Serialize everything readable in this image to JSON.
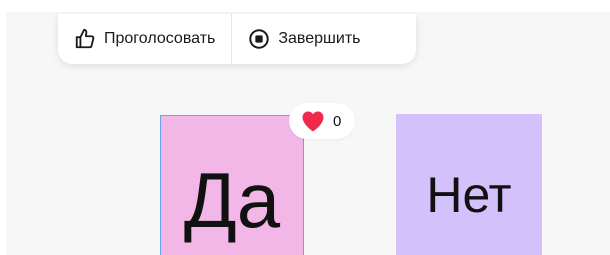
{
  "toolbar": {
    "vote_label": "Проголосовать",
    "finish_label": "Завершить"
  },
  "stickies": {
    "yes_text": "Да",
    "no_text": "Нет"
  },
  "reactions": {
    "like_count": "0"
  },
  "colors": {
    "sticky_yes_bg": "#f2b7e6",
    "sticky_no_bg": "#d2c1fb",
    "heart": "#f0284a",
    "selection_border": "#6aa3e8"
  },
  "icons": {
    "vote": "thumbs-up-icon",
    "finish": "stop-circle-icon",
    "like": "heart-icon"
  }
}
